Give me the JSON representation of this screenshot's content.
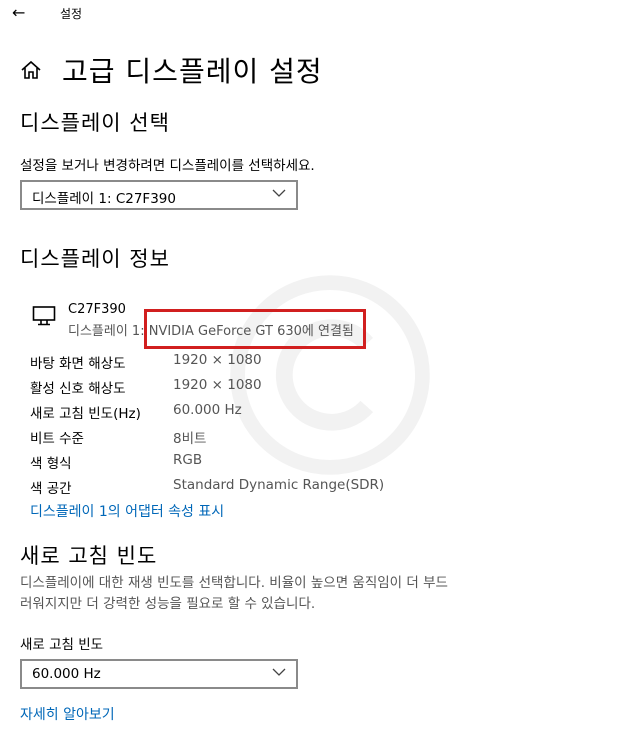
{
  "topbar": {
    "back_glyph": "←",
    "title": "설정"
  },
  "header": {
    "icon": "home-icon",
    "title": "고급 디스플레이 설정"
  },
  "select_display": {
    "heading": "디스플레이 선택",
    "instruction": "설정을 보거나 변경하려면 디스플레이를 선택하세요.",
    "selected": "디스플레이 1: C27F390"
  },
  "display_info": {
    "heading": "디스플레이 정보",
    "monitor_icon": "monitor-icon",
    "monitor_name": "C27F390",
    "connection": "디스플레이 1: NVIDIA GeForce GT 630에 연결됨",
    "rows": [
      {
        "label": "바탕 화면 해상도",
        "value": "1920 × 1080"
      },
      {
        "label": "활성 신호 해상도",
        "value": "1920 × 1080"
      },
      {
        "label": "새로 고침 빈도(Hz)",
        "value": "60.000 Hz"
      },
      {
        "label": "비트 수준",
        "value": "8비트"
      },
      {
        "label": "색 형식",
        "value": "RGB"
      },
      {
        "label": "색 공간",
        "value": "Standard Dynamic Range(SDR)"
      }
    ],
    "adapter_link": "디스플레이 1의 어댑터 속성 표시",
    "highlight_color": "#d11f1f"
  },
  "refresh_rate": {
    "heading": "새로 고침 빈도",
    "description": "디스플레이에 대한 재생 빈도를 선택합니다. 비율이 높으면 움직임이 더 부드러워지지만 더 강력한 성능을 필요로 할 수 있습니다.",
    "field_label": "새로 고침 빈도",
    "selected": "60.000 Hz",
    "learn_more": "자세히 알아보기"
  },
  "colors": {
    "link": "#0067b8",
    "secondary_text": "#555555",
    "border": "#8a8a8a"
  }
}
